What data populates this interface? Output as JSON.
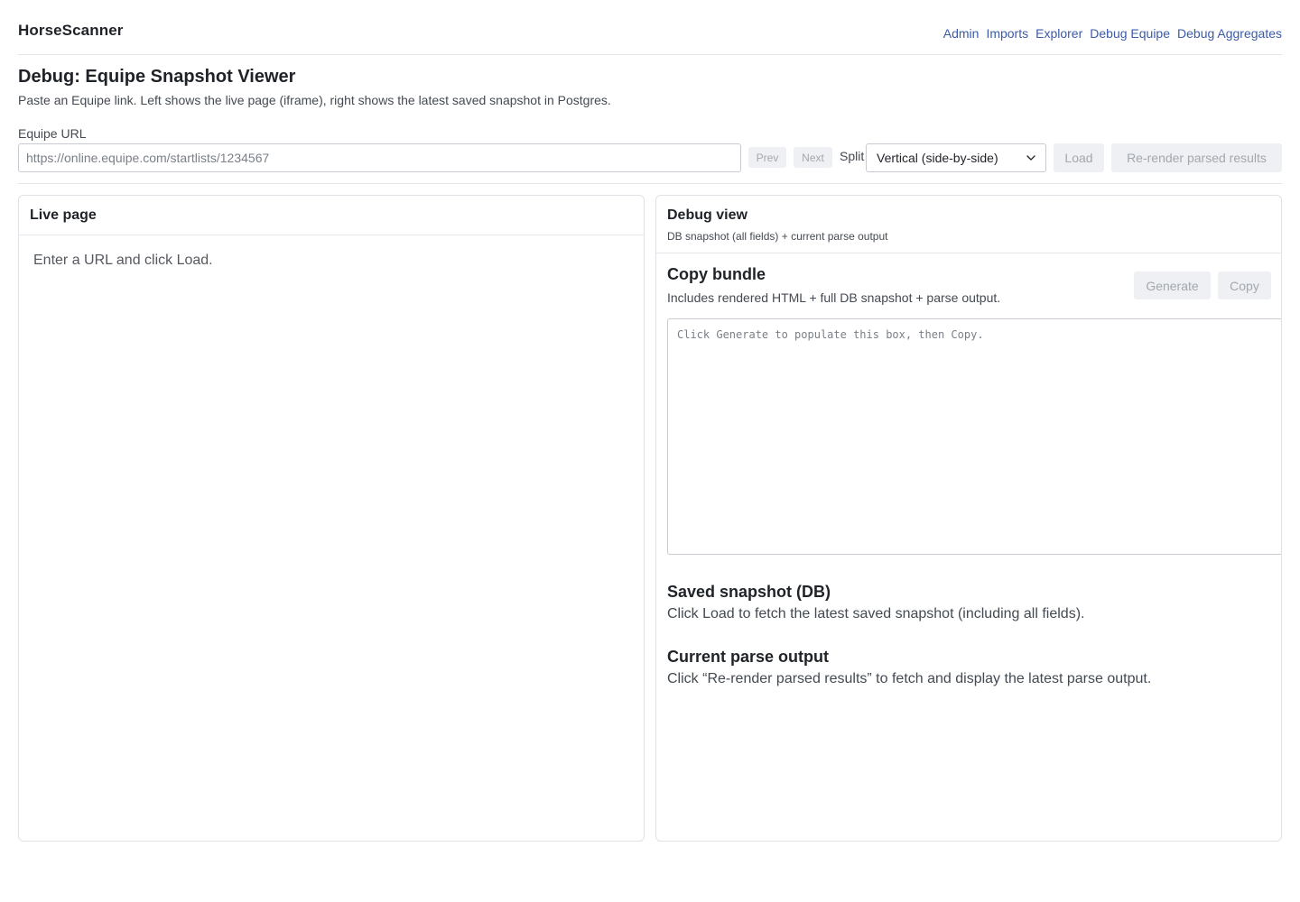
{
  "app": {
    "brand": "HorseScanner"
  },
  "nav": {
    "items": [
      "Admin",
      "Imports",
      "Explorer",
      "Debug Equipe",
      "Debug Aggregates"
    ]
  },
  "page": {
    "title": "Debug: Equipe Snapshot Viewer",
    "subtitle": "Paste an Equipe link. Left shows the live page (iframe), right shows the latest saved snapshot in Postgres."
  },
  "url_form": {
    "label": "Equipe URL",
    "value": "",
    "placeholder": "https://online.equipe.com/startlists/1234567",
    "prev_label": "Prev",
    "next_label": "Next",
    "split_label": "Split",
    "split_selected": "Vertical (side-by-side)",
    "load_label": "Load",
    "rerender_label": "Re-render parsed results"
  },
  "live_panel": {
    "title": "Live page",
    "empty_message": "Enter a URL and click Load."
  },
  "debug_panel": {
    "title": "Debug view",
    "subtitle": "DB snapshot (all fields) + current parse output",
    "copy_bundle": {
      "title": "Copy bundle",
      "description": "Includes rendered HTML + full DB snapshot + parse output.",
      "generate_label": "Generate",
      "copy_label": "Copy",
      "textarea_value": "",
      "textarea_placeholder": "Click Generate to populate this box, then Copy."
    },
    "saved_snapshot": {
      "title": "Saved snapshot (DB)",
      "text": "Click Load to fetch the latest saved snapshot (including all fields)."
    },
    "parse_output": {
      "title": "Current parse output",
      "text": "Click “Re-render parsed results” to fetch and display the latest parse output."
    }
  },
  "colors": {
    "link": "#3b5aa8",
    "border": "#dfe2e6",
    "disabled_button_bg": "#eef0f3",
    "disabled_button_text": "#a3a8af"
  },
  "icons": {
    "select_chevron": "chevron-down-icon"
  }
}
